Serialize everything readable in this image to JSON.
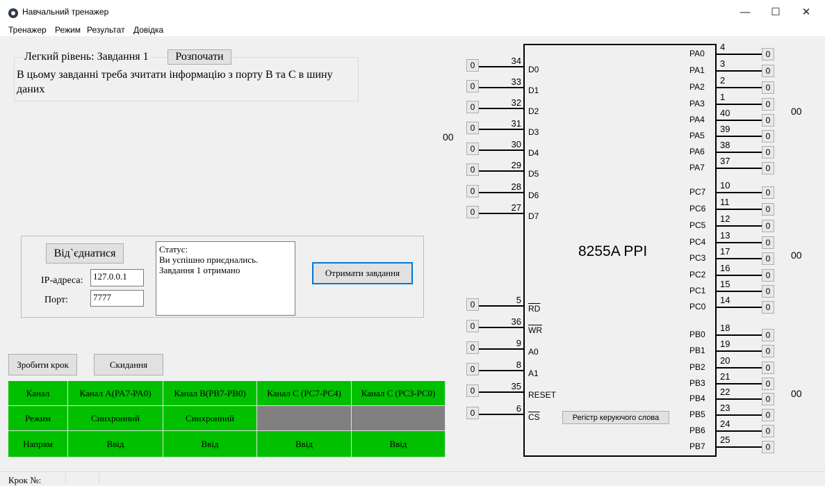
{
  "window": {
    "title": "Навчальний тренажер",
    "minimize": "—",
    "maximize": "☐",
    "close": "✕"
  },
  "menu": [
    "Тренажер",
    "Режим",
    "Результат",
    "Довідка"
  ],
  "task": {
    "level": "Легкий рівень: Завдання 1",
    "start_label": "Розпочати",
    "description": "В цьому завданні треба зчитати інформацію з порту В та С в шину даних"
  },
  "connection": {
    "disconnect_label": "Від`єднатися",
    "ip_label": "IP-адреса:",
    "ip_value": "127.0.0.1",
    "port_label": "Порт:",
    "port_value": "7777",
    "status_lines": [
      "Статус:",
      "Ви успішно приєднались.",
      "Завдання 1 отримано"
    ],
    "get_task_label": "Отримати завдання"
  },
  "controls": {
    "step_label": "Зробити крок",
    "reset_label": "Скидання"
  },
  "table": {
    "header": [
      "Канал",
      "Канал А(PA7-PA0)",
      "Канал В(PB7-PB0)",
      "Канал С (PC7-PC4)",
      "Канал С (PC3-PC0)"
    ],
    "mode": [
      "Режим",
      "Синхронний",
      "Синхронний",
      "",
      ""
    ],
    "direction": [
      "Напрям",
      "Ввід",
      "Ввід",
      "Ввід",
      "Ввід"
    ]
  },
  "chip": {
    "name": "8255A PPI",
    "control_register_label": "Регістр керуючого слова",
    "data_bus_value": "00",
    "port_a_value": "00",
    "port_c_value": "00",
    "port_b_value": "00",
    "left_pins": [
      {
        "label": "D0",
        "num": "34",
        "value": "0"
      },
      {
        "label": "D1",
        "num": "33",
        "value": "0"
      },
      {
        "label": "D2",
        "num": "32",
        "value": "0"
      },
      {
        "label": "D3",
        "num": "31",
        "value": "0"
      },
      {
        "label": "D4",
        "num": "30",
        "value": "0"
      },
      {
        "label": "D5",
        "num": "29",
        "value": "0"
      },
      {
        "label": "D6",
        "num": "28",
        "value": "0"
      },
      {
        "label": "D7",
        "num": "27",
        "value": "0"
      },
      {
        "label": "RD",
        "num": "5",
        "value": "0"
      },
      {
        "label": "WR",
        "num": "36",
        "value": "0"
      },
      {
        "label": "A0",
        "num": "9",
        "value": "0"
      },
      {
        "label": "A1",
        "num": "8",
        "value": "0"
      },
      {
        "label": "RESET",
        "num": "35",
        "value": "0"
      },
      {
        "label": "CS",
        "num": "6",
        "value": "0"
      }
    ],
    "right_pins": [
      {
        "label": "PA0",
        "num": "4",
        "value": "0"
      },
      {
        "label": "PA1",
        "num": "3",
        "value": "0"
      },
      {
        "label": "PA2",
        "num": "2",
        "value": "0"
      },
      {
        "label": "PA3",
        "num": "1",
        "value": "0"
      },
      {
        "label": "PA4",
        "num": "40",
        "value": "0"
      },
      {
        "label": "PA5",
        "num": "39",
        "value": "0"
      },
      {
        "label": "PA6",
        "num": "38",
        "value": "0"
      },
      {
        "label": "PA7",
        "num": "37",
        "value": "0"
      },
      {
        "label": "PC7",
        "num": "10",
        "value": "0"
      },
      {
        "label": "PC6",
        "num": "11",
        "value": "0"
      },
      {
        "label": "PC5",
        "num": "12",
        "value": "0"
      },
      {
        "label": "PC4",
        "num": "13",
        "value": "0"
      },
      {
        "label": "PC3",
        "num": "17",
        "value": "0"
      },
      {
        "label": "PC2",
        "num": "16",
        "value": "0"
      },
      {
        "label": "PC1",
        "num": "15",
        "value": "0"
      },
      {
        "label": "PC0",
        "num": "14",
        "value": "0"
      },
      {
        "label": "PB0",
        "num": "18",
        "value": "0"
      },
      {
        "label": "PB1",
        "num": "19",
        "value": "0"
      },
      {
        "label": "PB2",
        "num": "20",
        "value": "0"
      },
      {
        "label": "PB3",
        "num": "21",
        "value": "0"
      },
      {
        "label": "PB4",
        "num": "22",
        "value": "0"
      },
      {
        "label": "PB5",
        "num": "23",
        "value": "0"
      },
      {
        "label": "PB6",
        "num": "24",
        "value": "0"
      },
      {
        "label": "PB7",
        "num": "25",
        "value": "0"
      }
    ]
  },
  "statusbar": {
    "step_label": "Крок №:"
  }
}
